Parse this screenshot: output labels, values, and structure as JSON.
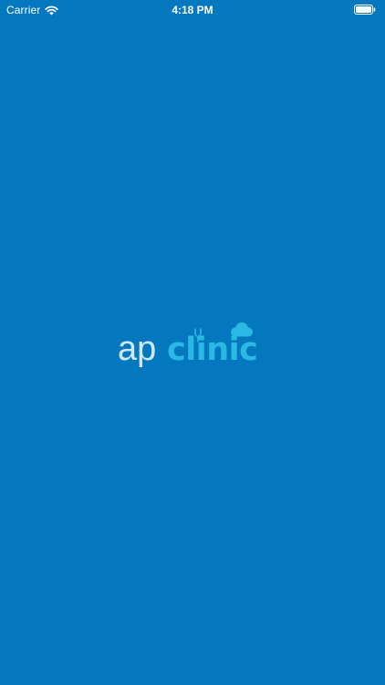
{
  "status_bar": {
    "carrier": "Carrier",
    "time": "4:18 PM",
    "wifi_icon": "wifi-icon",
    "battery_icon": "battery-icon",
    "battery_level": 1.0
  },
  "splash": {
    "brand_part_1": "ap",
    "brand_part_2": "clinic",
    "cloud_icon": "cloud-icon",
    "stethoscope_icon": "stethoscope-icon"
  },
  "colors": {
    "background": "#0478bf",
    "status_text": "#ffffff",
    "brand_ap": "#cfe8f4",
    "brand_clinic": "#29b9e3"
  }
}
